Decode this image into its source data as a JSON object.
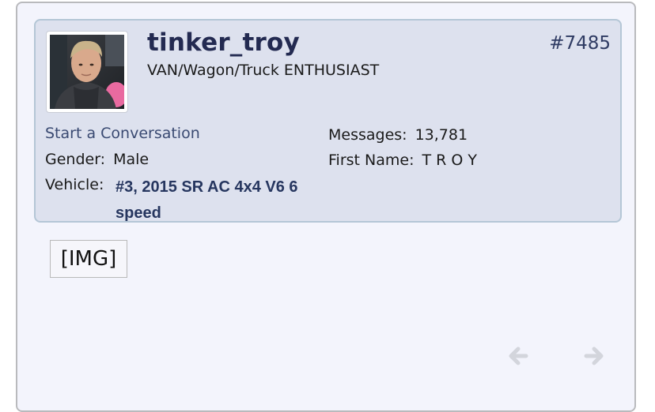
{
  "post": {
    "username": "tinker_troy",
    "user_title": "VAN/Wagon/Truck ENTHUSIAST",
    "post_number": "#7485",
    "start_conversation": "Start a Conversation",
    "gender_label": "Gender:",
    "gender_value": "Male",
    "vehicle_label": "Vehicle:",
    "vehicle_value": "#3, 2015 SR AC 4x4 V6 6 speed",
    "messages_label": "Messages:",
    "messages_value": "13,781",
    "first_name_label": "First Name:",
    "first_name_value": "T R O Y",
    "image_placeholder": "[IMG]"
  },
  "navigation": {
    "prev_icon": "arrow-left-icon",
    "next_icon": "arrow-right-icon"
  },
  "colors": {
    "card_background": "#f3f4fc",
    "userinfo_background": "#dde1ee",
    "username": "#232a51",
    "link": "#3a4a72",
    "vehicle": "#26365f"
  }
}
